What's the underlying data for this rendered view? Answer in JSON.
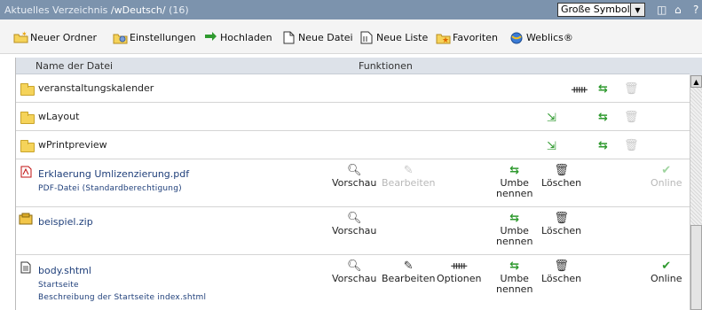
{
  "titlebar": {
    "prefix": "Aktuelles Verzeichnis",
    "path": "/wDeutsch/",
    "count": "(16)",
    "view_select": "Große Symbole",
    "icons": [
      "window-icon",
      "home-icon",
      "help-icon"
    ],
    "help_glyph": "?"
  },
  "toolbar": {
    "new_folder": "Neuer Ordner",
    "settings": "Einstellungen",
    "upload": "Hochladen",
    "new_file": "Neue Datei",
    "new_list": "Neue Liste",
    "favorites": "Favoriten",
    "weblics": "Weblics®"
  },
  "columns": {
    "name": "Name der Datei",
    "functions": "Funktionen"
  },
  "rows": [
    {
      "name": "veranstaltungskalender",
      "type": "folder"
    },
    {
      "name": "wLayout",
      "type": "folder"
    },
    {
      "name": "wPrintpreview",
      "type": "folder"
    },
    {
      "name": "Erklaerung Umlizenzierung.pdf",
      "type": "pdf",
      "sub1": "PDF-Datei (Standardberechtigung)"
    },
    {
      "name": "beispiel.zip",
      "type": "zip"
    },
    {
      "name": "body.shtml",
      "type": "file",
      "sub1": "Startseite",
      "sub2": "Beschreibung der Startseite index.shtml"
    }
  ],
  "functions": {
    "preview": "Vorschau",
    "edit": "Bearbeiten",
    "options": "Optionen",
    "rename_1": "Umbe",
    "rename_2": "nennen",
    "delete": "Löschen",
    "online": "Online"
  },
  "colors": {
    "titlebar_bg": "#7c93ad",
    "link_blue": "#1f3f7a",
    "green": "#2f9a2f"
  }
}
